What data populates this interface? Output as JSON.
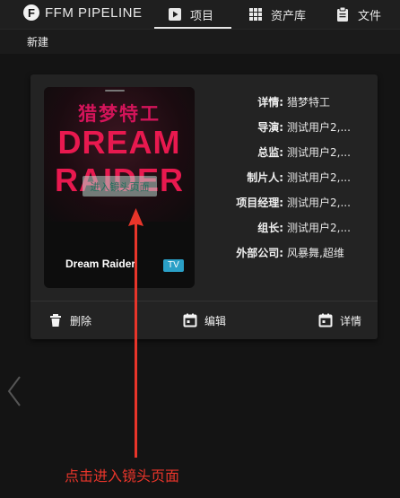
{
  "nav": {
    "brand_logo": "F",
    "brand": "FFM PIPELINE",
    "items": [
      {
        "label": "项目",
        "icon": "play-box-icon"
      },
      {
        "label": "资产库",
        "icon": "grid-icon"
      },
      {
        "label": "文件",
        "icon": "clipboard-icon"
      }
    ]
  },
  "toolbar": {
    "new_label": "新建"
  },
  "card": {
    "poster": {
      "title_cn": "猎梦特工",
      "title_en_1": "DREAM",
      "title_en_2": "RAIDER",
      "enter_button": "进入镜头页面",
      "name": "Dream Raider",
      "badge": "TV"
    },
    "details": [
      {
        "label": "详情:",
        "value": "猎梦特工"
      },
      {
        "label": "导演:",
        "value": "测试用户2,..."
      },
      {
        "label": "总监:",
        "value": "测试用户2,..."
      },
      {
        "label": "制片人:",
        "value": "测试用户2,..."
      },
      {
        "label": "项目经理:",
        "value": "测试用户2,..."
      },
      {
        "label": "组长:",
        "value": "测试用户2,..."
      },
      {
        "label": "外部公司:",
        "value": "风暴舞,超维"
      }
    ],
    "actions": {
      "delete": "删除",
      "edit": "编辑",
      "detail": "详情"
    }
  },
  "annotation": "点击进入镜头页面",
  "colors": {
    "accent_red": "#e8352a",
    "badge_blue": "#2aa0c7"
  }
}
